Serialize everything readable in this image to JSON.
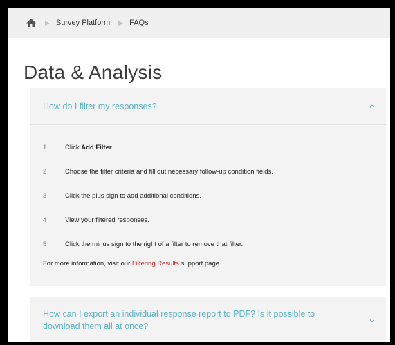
{
  "breadcrumb": {
    "items": [
      "Survey Platform",
      "FAQs"
    ]
  },
  "page": {
    "title": "Data & Analysis"
  },
  "faq": [
    {
      "question": "How do I filter my responses?",
      "expanded": true,
      "steps": [
        {
          "num": "1",
          "pre": "Click ",
          "bold": "Add Filter",
          "post": "."
        },
        {
          "num": "2",
          "pre": "Choose the filter criteria and fill out necessary follow-up condition fields.",
          "bold": "",
          "post": ""
        },
        {
          "num": "3",
          "pre": "Click the plus sign to add additional conditions.",
          "bold": "",
          "post": ""
        },
        {
          "num": "4",
          "pre": "View your filtered responses.",
          "bold": "",
          "post": ""
        },
        {
          "num": "5",
          "pre": "Click the minus sign to the right of a filter to remove that filter.",
          "bold": "",
          "post": ""
        }
      ],
      "more_pre": "For more information, visit our ",
      "more_link": "Filtering Results",
      "more_post": " support page."
    },
    {
      "question": "How can I export an individual response report to PDF? Is it possible to download them all at once?",
      "expanded": false
    }
  ],
  "colors": {
    "accent": "#5bb3c6",
    "link": "#d42b2b",
    "panel": "#f3f3f3"
  }
}
